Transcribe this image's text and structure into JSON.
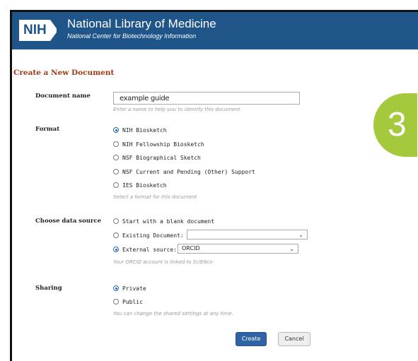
{
  "header": {
    "logo_text": "NIH",
    "title": "National Library of Medicine",
    "subtitle": "National Center for Biotechnology Information"
  },
  "page_heading": "Create a New Document",
  "document_name": {
    "label": "Document name",
    "value": "example guide",
    "hint": "Enter a name to help you to identify this document"
  },
  "format": {
    "label": "Format",
    "options": [
      {
        "label": "NIH Biosketch",
        "checked": true
      },
      {
        "label": "NIH Fellowship Biosketch",
        "checked": false
      },
      {
        "label": "NSF Biographical Sketch",
        "checked": false
      },
      {
        "label": "NSF Current and Pending (Other) Support",
        "checked": false
      },
      {
        "label": "IES Biosketch",
        "checked": false
      }
    ],
    "hint": "Select a format for this document"
  },
  "data_source": {
    "label": "Choose data source",
    "options": [
      {
        "label": "Start with a blank document",
        "checked": false
      },
      {
        "label": "Existing Document:",
        "checked": false
      },
      {
        "label": "External source:",
        "checked": true
      }
    ],
    "existing_select_value": "",
    "external_select_value": "ORCID",
    "hint": "Your ORCID account is linked to SciENcv."
  },
  "sharing": {
    "label": "Sharing",
    "options": [
      {
        "label": "Private",
        "checked": true
      },
      {
        "label": "Public",
        "checked": false
      }
    ],
    "hint": "You can change the shared settings at any time."
  },
  "buttons": {
    "create": "Create",
    "cancel": "Cancel"
  },
  "step_badge": "3",
  "colors": {
    "header_bg": "#20558a",
    "heading": "#9a3b16",
    "primary_button": "#2f63a5",
    "badge": "#a5c93c",
    "radio_checked": "#2a66b8"
  },
  "icons": {
    "select_chevron": "chevron-down-icon",
    "logo": "nih-logo"
  }
}
